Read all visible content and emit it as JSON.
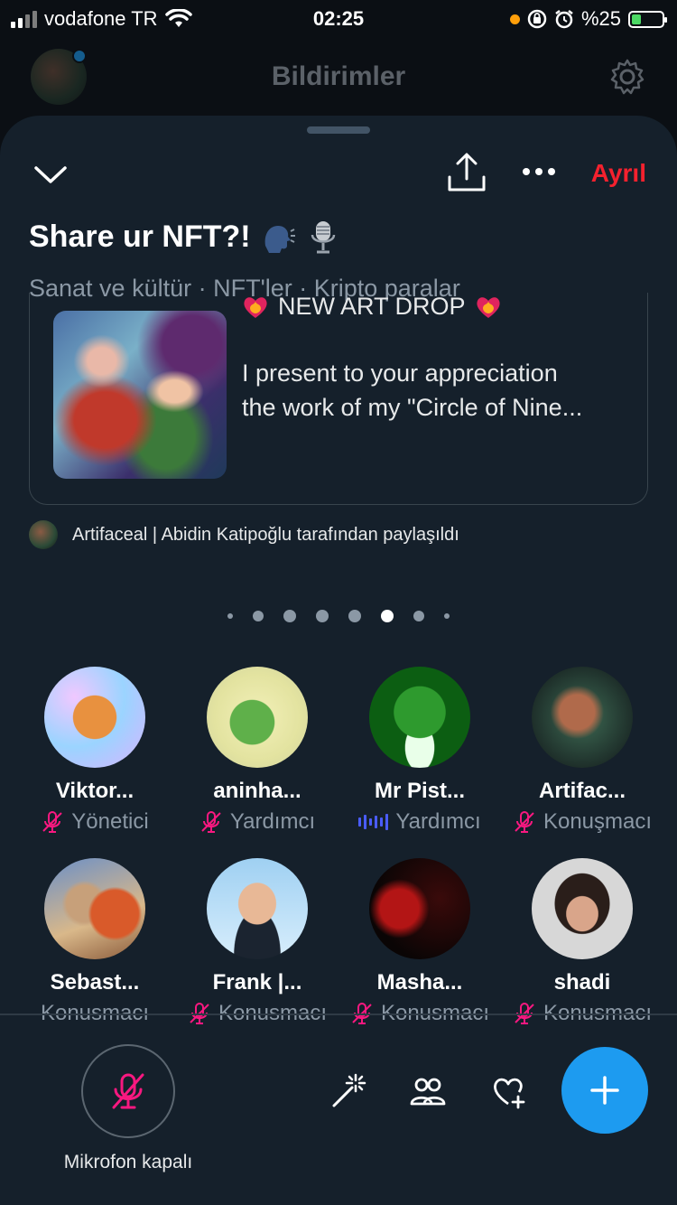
{
  "status_bar": {
    "carrier": "vodafone TR",
    "time": "02:25",
    "battery": "%25"
  },
  "background": {
    "title": "Bildirimler"
  },
  "space": {
    "leave_label": "Ayrıl",
    "title": "Share ur NFT?!",
    "topics": "Sanat ve kültür · NFT'ler · Kripto paralar",
    "pinned_tweet": {
      "headline": "NEW ART DROP",
      "line1": "I present to your appreciation",
      "line2": "the work of my \"Circle of Nine..."
    },
    "shared_by": "Artifaceal | Abidin Katipoğlu tarafından paylaşıldı",
    "pager": {
      "count": 8,
      "active_index": 5
    }
  },
  "participants": [
    {
      "name": "Viktor...",
      "role": "Yönetici",
      "mic": "off"
    },
    {
      "name": "aninha...",
      "role": "Yardımcı",
      "mic": "off"
    },
    {
      "name": "Mr Pist...",
      "role": "Yardımcı",
      "mic": "speaking"
    },
    {
      "name": "Artifac...",
      "role": "Konuşmacı",
      "mic": "off"
    },
    {
      "name": "Sebast...",
      "role": "Konusmacı",
      "mic": "none"
    },
    {
      "name": "Frank |...",
      "role": "Konusmacı",
      "mic": "off"
    },
    {
      "name": "Masha...",
      "role": "Konusmacı",
      "mic": "off"
    },
    {
      "name": "shadi",
      "role": "Konusmacı",
      "mic": "off"
    }
  ],
  "bottom_bar": {
    "mic_label": "Mikrofon kapalı"
  },
  "colors": {
    "accent": "#1d9bf0",
    "danger": "#f4212e",
    "mic_off": "#f91880",
    "speaking": "#4a5cff"
  }
}
